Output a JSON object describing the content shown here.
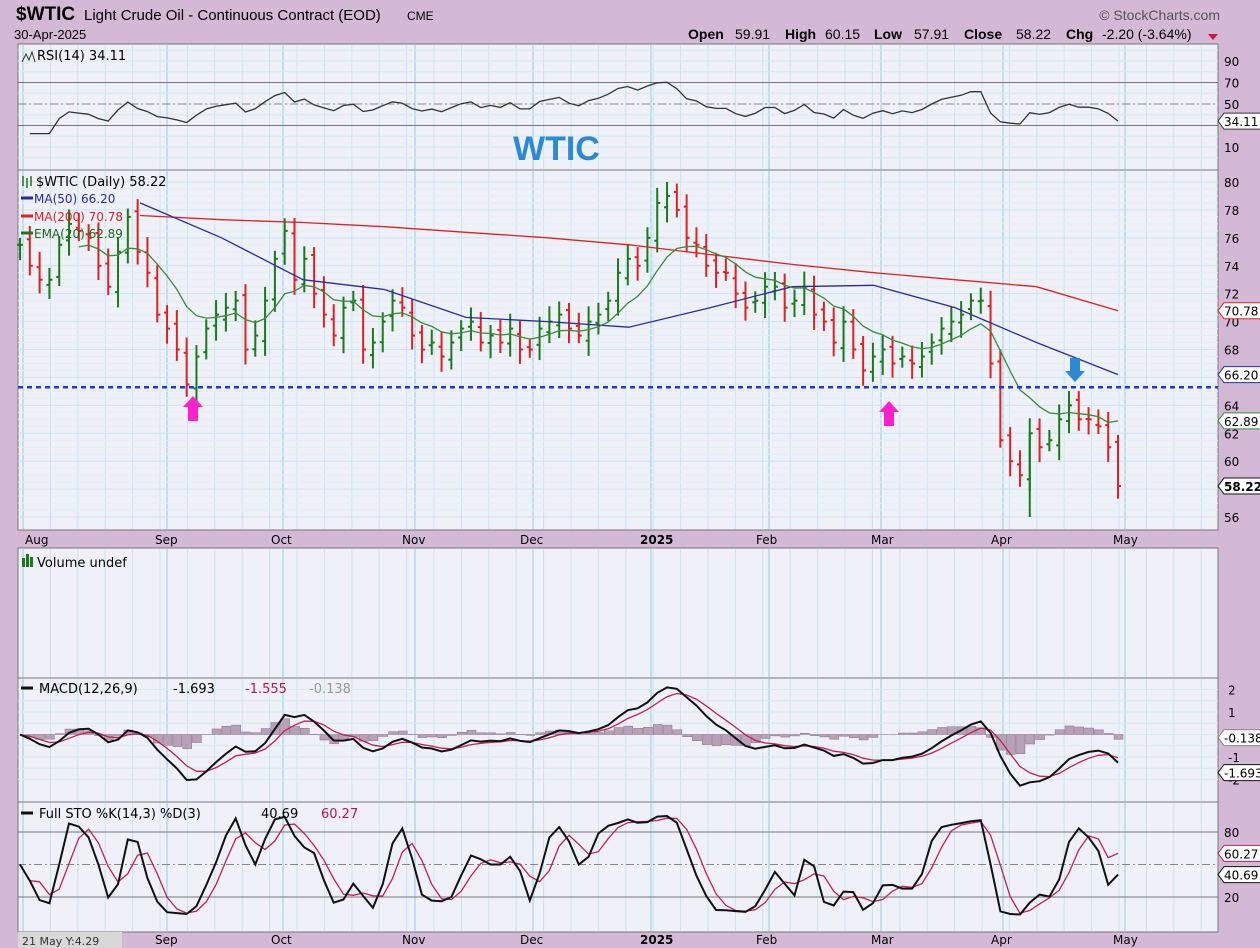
{
  "header": {
    "symbol": "$WTIC",
    "name": "Light Crude Oil - Continuous Contract (EOD)",
    "exchange": "CME",
    "date": "30-Apr-2025",
    "copyright": "© StockCharts.com",
    "open_label": "Open",
    "open": "59.91",
    "high_label": "High",
    "high": "60.15",
    "low_label": "Low",
    "low": "57.91",
    "close_label": "Close",
    "close": "58.22",
    "chg_label": "Chg",
    "chg": "-2.20 (-3.64%)"
  },
  "watermark": "WTIC",
  "footer": {
    "cursor_readout": "21 May Y:4.29"
  },
  "colors": {
    "up": "#1a7a1a",
    "down": "#dd2222",
    "ma50": "#2a2aa0",
    "ma200": "#e02020",
    "ema20": "#3a8a3a",
    "support": "#1a3adf",
    "arrow_up": "#ff22cc",
    "arrow_down": "#2a8ad8",
    "watermark": "#2a8ad8"
  },
  "chart_data": [
    {
      "type": "line",
      "panel": "rsi",
      "title": "RSI(14) 34.11",
      "legend": "RSI(14) 34.11",
      "value_tag": "34.11",
      "yticks": [
        "90",
        "70",
        "50",
        "10"
      ],
      "ylim": [
        0,
        100
      ]
    },
    {
      "type": "ohlc",
      "panel": "price",
      "legend": "$WTIC (Daily) 58.22",
      "series_legends": [
        {
          "name": "MA(50) 66.20",
          "tag": "66.20"
        },
        {
          "name": "MA(200) 70.78",
          "tag": "70.78"
        },
        {
          "name": "EMA(20) 62.89",
          "tag": "62.89"
        }
      ],
      "last_tag": "58.22",
      "yticks": [
        "80",
        "78",
        "76",
        "74",
        "72",
        "70",
        "68",
        "66",
        "64",
        "62",
        "60",
        "58",
        "56"
      ],
      "ylim": [
        55,
        81
      ],
      "xticks": [
        "Aug",
        "Sep",
        "Oct",
        "Nov",
        "Dec",
        "2025",
        "Feb",
        "Mar",
        "Apr",
        "May"
      ],
      "closes": [
        75.5,
        74,
        73,
        73,
        75.5,
        77,
        76.5,
        76,
        74,
        72.5,
        75,
        77.5,
        75,
        73.5,
        70.5,
        69.5,
        68,
        65.5,
        67.5,
        69.5,
        70.5,
        71,
        71.5,
        68,
        69,
        71.5,
        74.5,
        76.5,
        73,
        74.5,
        72,
        70.5,
        69,
        71,
        71.5,
        68,
        68.5,
        70,
        71.5,
        71,
        69,
        68,
        68.5,
        67.5,
        68.5,
        69.5,
        70,
        68.5,
        69,
        68.5,
        69.5,
        68,
        68,
        69.5,
        70,
        70.5,
        69.5,
        69,
        70,
        70.5,
        71.5,
        73.5,
        74.5,
        74,
        76,
        78.5,
        79,
        78,
        76,
        75.5,
        74,
        73.5,
        73.5,
        72,
        71,
        71.5,
        72.5,
        72.5,
        71,
        71.5,
        72.5,
        70.5,
        70,
        68.5,
        70,
        68,
        66.5,
        67.5,
        68,
        67,
        67.5,
        67,
        67.5,
        68.5,
        69.5,
        70,
        70.5,
        71.5,
        71.5,
        67,
        61.5,
        60,
        59,
        62,
        61,
        61.5,
        63,
        64,
        63,
        63,
        62.5,
        61,
        58.22
      ],
      "ma50": [
        78.5,
        76,
        73,
        72.3,
        70.3,
        70,
        69.6,
        71,
        72.5,
        72.6,
        71,
        68.5,
        66.2
      ],
      "ma200": [
        77.6,
        77.3,
        77.1,
        76.8,
        76.4,
        76,
        75.5,
        74.8,
        74.1,
        73.5,
        73,
        72.5,
        70.78
      ],
      "support_level": 65.3,
      "annotations": [
        "up-arrow at Sep low",
        "up-arrow at Mar low",
        "down-arrow at Apr retest"
      ]
    },
    {
      "type": "bar",
      "panel": "volume",
      "legend": "Volume undef"
    },
    {
      "type": "line",
      "panel": "macd",
      "legend": "MACD(12,26,9)",
      "macd": "-1.693",
      "signal": "-1.555",
      "histogram": "-0.138",
      "tags": [
        "-0.138",
        "-1.693"
      ],
      "yticks": [
        "2",
        "1",
        "-1",
        "-2"
      ]
    },
    {
      "type": "line",
      "panel": "stochastic",
      "legend": "Full STO %K(14,3) %D(3)",
      "k": "40.69",
      "d": "60.27",
      "tags": [
        "60.27",
        "40.69"
      ],
      "yticks": [
        "80",
        "20"
      ]
    }
  ]
}
